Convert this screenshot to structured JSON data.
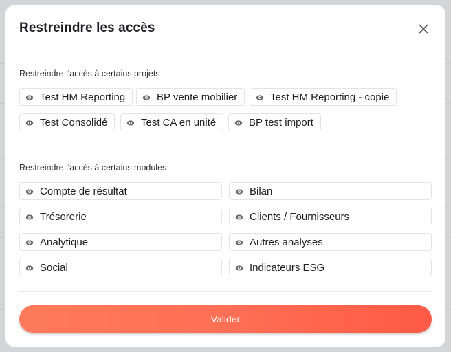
{
  "modal": {
    "title": "Restreindre les accès",
    "close_icon": "close-icon"
  },
  "projects": {
    "label": "Restreindre l'accès à certains projets",
    "items": [
      "Test HM Reporting",
      "BP vente mobilier",
      "Test HM Reporting - copie",
      "Test Consolidé",
      "Test CA en unité",
      "BP test import"
    ],
    "icon": "eye-icon"
  },
  "modules": {
    "label": "Restreindre l'accès à certains modules",
    "items": [
      "Compte de résultat",
      "Bilan",
      "Trésorerie",
      "Clients / Fournisseurs",
      "Analytique",
      "Autres analyses",
      "Social",
      "Indicateurs ESG"
    ],
    "icon": "eye-icon"
  },
  "footer": {
    "submit_label": "Valider"
  },
  "colors": {
    "accent_start": "#ff7a5a",
    "accent_end": "#ff5a45",
    "icon": "#6b6b70"
  }
}
